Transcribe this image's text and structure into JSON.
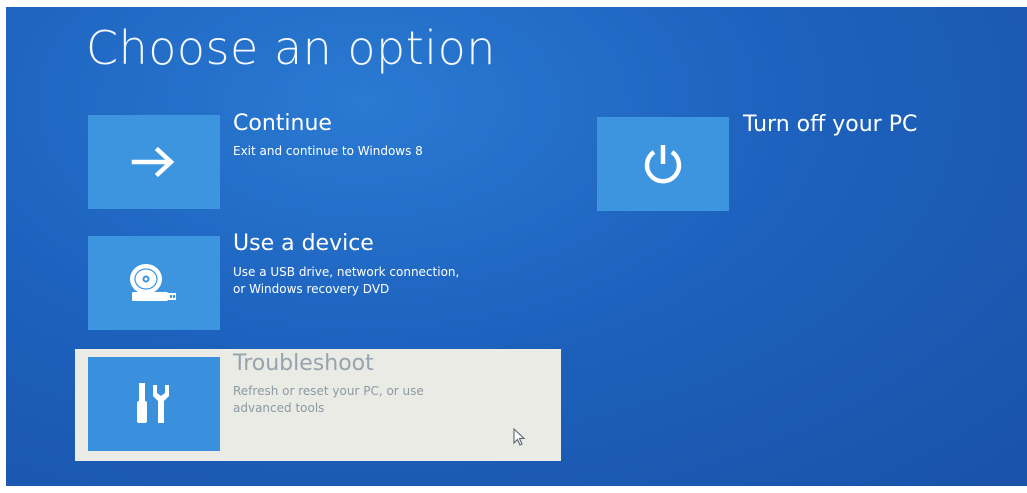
{
  "screen": {
    "title": "Choose an option"
  },
  "options": {
    "continue": {
      "title": "Continue",
      "description": "Exit and continue to Windows 8",
      "icon": "arrow-right-icon"
    },
    "use_device": {
      "title": "Use a device",
      "description_line1": "Use a USB drive, network connection,",
      "description_line2": "or Windows recovery DVD",
      "icon": "disc-drive-icon"
    },
    "troubleshoot": {
      "title": "Troubleshoot",
      "description_line1": "Refresh or reset your PC, or use",
      "description_line2": "advanced tools",
      "icon": "tools-icon",
      "state": "hovered"
    },
    "turn_off": {
      "title": "Turn off your PC",
      "icon": "power-icon"
    }
  },
  "colors": {
    "background": "#1d62be",
    "tile": "#3d95e0",
    "highlight": "#e9ebe4",
    "text": "#ffffff"
  }
}
